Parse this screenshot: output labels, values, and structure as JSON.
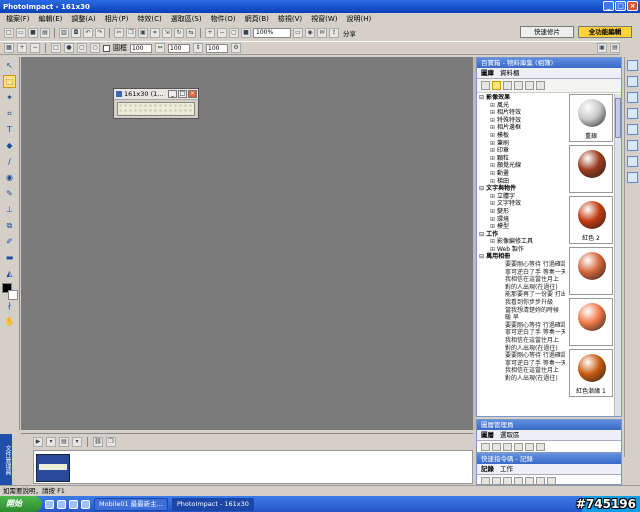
{
  "app": {
    "title": "PhotoImpact - 161x30"
  },
  "menu": [
    "檔案(F)",
    "編輯(E)",
    "調整(A)",
    "相片(P)",
    "特效(C)",
    "選取區(S)",
    "物件(O)",
    "網頁(B)",
    "檢視(V)",
    "視窗(W)",
    "說明(H)"
  ],
  "modes": {
    "quick": "快速修片",
    "full": "全功能編輯"
  },
  "toolbar": {
    "zoom": "100%",
    "share": "分享"
  },
  "attributes": {
    "checkbox_label": "圓框",
    "value1": "100",
    "value2": "100",
    "value3": "100"
  },
  "document": {
    "title": "161x30 (1..."
  },
  "panel": {
    "title": "百寶箱 - 物料庫集 (相簿)",
    "tabs": [
      "圖庫",
      "資料櫃"
    ],
    "tree": [
      {
        "type": "head",
        "text": "影像效果"
      },
      {
        "type": "child",
        "text": "風光"
      },
      {
        "type": "child",
        "text": "相片特效"
      },
      {
        "type": "child",
        "text": "特殊特效"
      },
      {
        "type": "child",
        "text": "相片邊框"
      },
      {
        "type": "child",
        "text": "模板"
      },
      {
        "type": "child",
        "text": "筆刷"
      },
      {
        "type": "child",
        "text": "印章"
      },
      {
        "type": "child",
        "text": "顆粒"
      },
      {
        "type": "child",
        "text": "顏覺光線"
      },
      {
        "type": "child",
        "text": "動畫"
      },
      {
        "type": "child",
        "text": "梯田"
      },
      {
        "type": "head",
        "text": "文字與物件"
      },
      {
        "type": "child",
        "text": "立體字"
      },
      {
        "type": "child",
        "text": "文字特效"
      },
      {
        "type": "child",
        "text": "變形"
      },
      {
        "type": "child",
        "text": "環境"
      },
      {
        "type": "child",
        "text": "模型"
      },
      {
        "type": "head",
        "text": "工作"
      },
      {
        "type": "child",
        "text": "影像編修工具"
      },
      {
        "type": "child",
        "text": "Web 製作"
      },
      {
        "type": "head",
        "text": "萬用相冊"
      },
      {
        "type": "verse",
        "text": "要要剛心等待  行過確認"
      },
      {
        "type": "verse",
        "text": "寧可逆白了手  等奏一天"
      },
      {
        "type": "verse",
        "text": "我相信在這當住月上"
      },
      {
        "type": "verse",
        "text": "對的人出現(在過往)"
      },
      {
        "type": "verse",
        "text": "能那要再了一份要  打出聲音"
      },
      {
        "type": "verse",
        "text": "我看到你步步升級"
      },
      {
        "type": "verse",
        "text": "當我想清楚妳的時候"
      },
      {
        "type": "verse",
        "text": "暖  早"
      },
      {
        "type": "verse",
        "text": "要要剛心等待  行過確認"
      },
      {
        "type": "verse",
        "text": "寧可逆白了手  等奏一天"
      },
      {
        "type": "verse",
        "text": "我相信在這當住月上"
      },
      {
        "type": "verse",
        "text": "對的人出現(在過往)"
      },
      {
        "type": "verse",
        "text": "要要剛心等待  行過確認"
      },
      {
        "type": "verse",
        "text": "寧可逆白了手  等奏一天"
      },
      {
        "type": "verse",
        "text": "我相信在這當住月上"
      },
      {
        "type": "verse",
        "text": "對的人出現(在過往)"
      }
    ],
    "thumbs": [
      {
        "label": "重銀",
        "color": "#c8c8c8"
      },
      {
        "label": "",
        "color": "#9a3a1c"
      },
      {
        "label": "紅色 2",
        "color": "#c23a10"
      },
      {
        "label": "",
        "color": "#d4663a"
      },
      {
        "label": "",
        "color": "#f07848"
      },
      {
        "label": "紅色漸緣 1",
        "color": "#c85a10"
      }
    ]
  },
  "panel2": {
    "title": "圖層管理員",
    "tabs": [
      "圖層",
      "選取區"
    ]
  },
  "panel3": {
    "title": "快速指令碼 - 記錄",
    "tabs": [
      "記錄",
      "工作"
    ]
  },
  "status": {
    "text": "如需要說明，請按 F1"
  },
  "taskbar": {
    "start": "開始",
    "tasks": [
      "Mobile01 最最新主...",
      "PhotoImpact - 161x30"
    ]
  },
  "watermark": "#745196"
}
